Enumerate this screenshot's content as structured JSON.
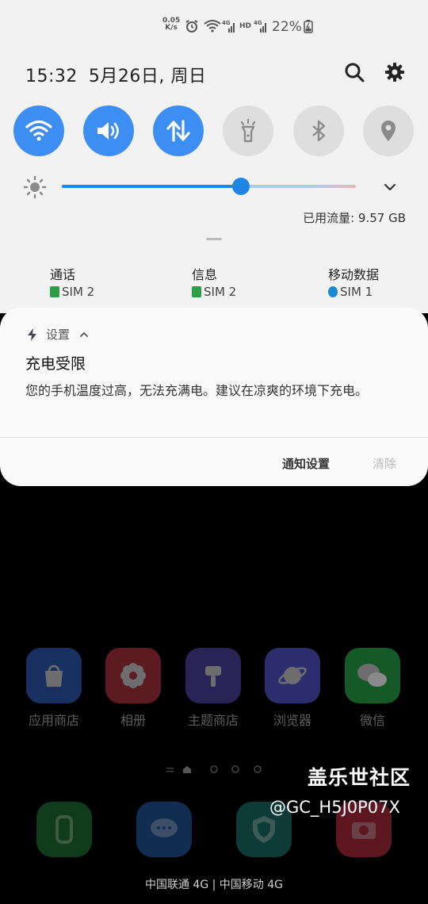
{
  "status_bar": {
    "net_speed": "0.05\nK/s",
    "hd_label": "HD",
    "network_type_1": "4G",
    "network_type_2": "4G",
    "battery_percent": "22%"
  },
  "header": {
    "time": "15:32",
    "date": "5月26日, 周日"
  },
  "quick_settings": [
    {
      "name": "wifi",
      "on": true
    },
    {
      "name": "sound",
      "on": true
    },
    {
      "name": "mobile-data",
      "on": true
    },
    {
      "name": "flashlight",
      "on": false
    },
    {
      "name": "bluetooth",
      "on": false
    },
    {
      "name": "location",
      "on": false
    }
  ],
  "brightness": {
    "level": 0.61
  },
  "data_usage": "已用流量: 9.57 GB",
  "sim": [
    {
      "label": "通话",
      "value": "SIM 2",
      "icon": "phone-icon",
      "color": "#2e9d48"
    },
    {
      "label": "信息",
      "value": "SIM 2",
      "icon": "message-icon",
      "color": "#2e9d48"
    },
    {
      "label": "移动数据",
      "value": "SIM 1",
      "icon": "globe-icon",
      "color": "#1a8ad4"
    }
  ],
  "notification": {
    "app_name": "设置",
    "title": "充电受限",
    "body": "您的手机温度过高，无法充满电。建议在凉爽的环境下充电。",
    "action_settings": "通知设置",
    "action_clear": "清除"
  },
  "home": {
    "apps": [
      {
        "label": "应用商店",
        "color": "#2d6bd8"
      },
      {
        "label": "相册",
        "color": "#e03a44"
      },
      {
        "label": "主题商店",
        "color": "#5050d6"
      },
      {
        "label": "浏览器",
        "color": "#5b5df0"
      },
      {
        "label": "微信",
        "color": "#2bb24c"
      }
    ],
    "dock": [
      {
        "name": "phone",
        "color": "#1d7d3a"
      },
      {
        "name": "messages",
        "color": "#1e63b4"
      },
      {
        "name": "security",
        "color": "#1b7d78"
      },
      {
        "name": "camera",
        "color": "#d8344a"
      }
    ],
    "carrier": "中国联通 4G | 中国移动 4G",
    "watermark_site": "盖乐世社区",
    "watermark_user": "@GC_H5J0P07X"
  }
}
